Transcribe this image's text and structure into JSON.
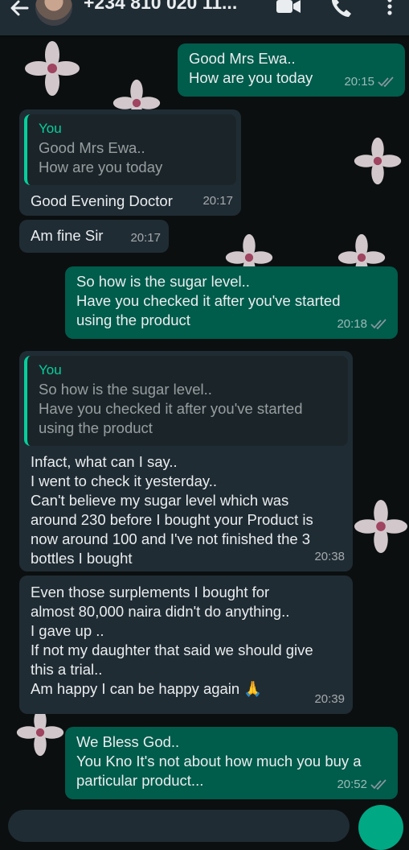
{
  "header": {
    "contact_name": "+234 810 020 11...",
    "icons": [
      "back-arrow-icon",
      "video-call-icon",
      "phone-icon",
      "more-vert-icon"
    ]
  },
  "messages": [
    {
      "direction": "out",
      "text": "Good Mrs Ewa..\nHow are you today",
      "time": "20:15"
    },
    {
      "direction": "in",
      "quote_author": "You",
      "quote_text": "Good Mrs Ewa..\nHow are you today",
      "text": "Good Evening Doctor",
      "time": "20:17"
    },
    {
      "direction": "in",
      "text": "Am fine Sir",
      "time": "20:17"
    },
    {
      "direction": "out",
      "text": "So how is the sugar level..\nHave you checked it after you've started\nusing the product",
      "time": "20:18"
    },
    {
      "direction": "in",
      "quote_author": "You",
      "quote_text": "So how is the sugar level..\nHave you checked it after you've started\nusing the product",
      "text": "Infact, what can I say..\nI went to check it yesterday..\nCan't believe my sugar level which was\naround 230 before I bought your Product is\nnow around 100 and I've not finished the 3\nbottles I bought",
      "time": "20:38"
    },
    {
      "direction": "in",
      "text": "Even those surplements I bought for\nalmost 80,000 naira didn't do anything..\nI gave up ..\nIf not my daughter that said we should give\nthis a trial..\nAm happy I can be happy again 🙏",
      "time": "20:39"
    },
    {
      "direction": "out",
      "text": "We Bless God..\nYou Kno It's not about how much you buy a\nparticular product...",
      "time": "20:52"
    }
  ],
  "colors": {
    "outgoing_bubble": "#005c4b",
    "incoming_bubble": "#202c33",
    "header": "#1f2c33",
    "quote_accent": "#06cf9c",
    "read_ticks": "#8696a0"
  }
}
